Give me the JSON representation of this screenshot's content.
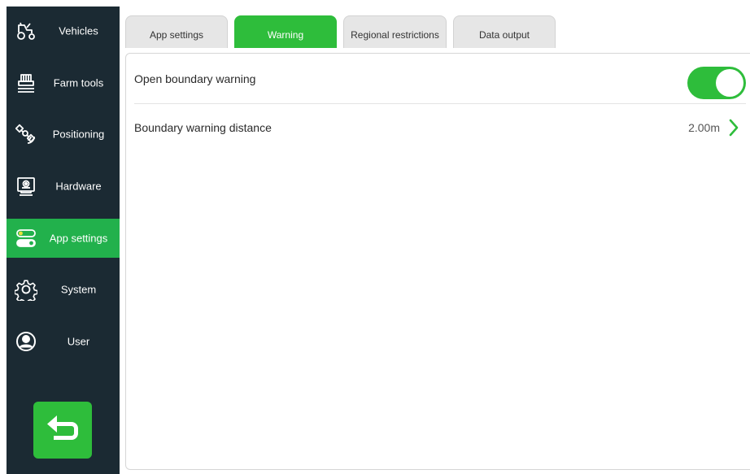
{
  "sidebar": {
    "items": [
      {
        "label": "Vehicles",
        "icon": "tractor-icon"
      },
      {
        "label": "Farm tools",
        "icon": "farm-tool-icon"
      },
      {
        "label": "Positioning",
        "icon": "satellite-icon"
      },
      {
        "label": "Hardware",
        "icon": "hardware-icon"
      },
      {
        "label": "App settings",
        "icon": "toggles-icon",
        "active": true
      },
      {
        "label": "System",
        "icon": "gear-icon"
      },
      {
        "label": "User",
        "icon": "user-icon"
      }
    ],
    "back_icon": "back-arrow-icon"
  },
  "tabs": [
    {
      "label": "App settings"
    },
    {
      "label": "Warning",
      "active": true
    },
    {
      "label": "Regional restrictions"
    },
    {
      "label": "Data output"
    }
  ],
  "settings": {
    "open_boundary_warning": {
      "label": "Open boundary warning",
      "enabled": true
    },
    "boundary_warning_distance": {
      "label": "Boundary warning distance",
      "value": "2.00m"
    }
  },
  "colors": {
    "sidebar_bg": "#1b2a33",
    "accent_green": "#2ebd3b",
    "tab_inactive": "#e6e6e6"
  }
}
